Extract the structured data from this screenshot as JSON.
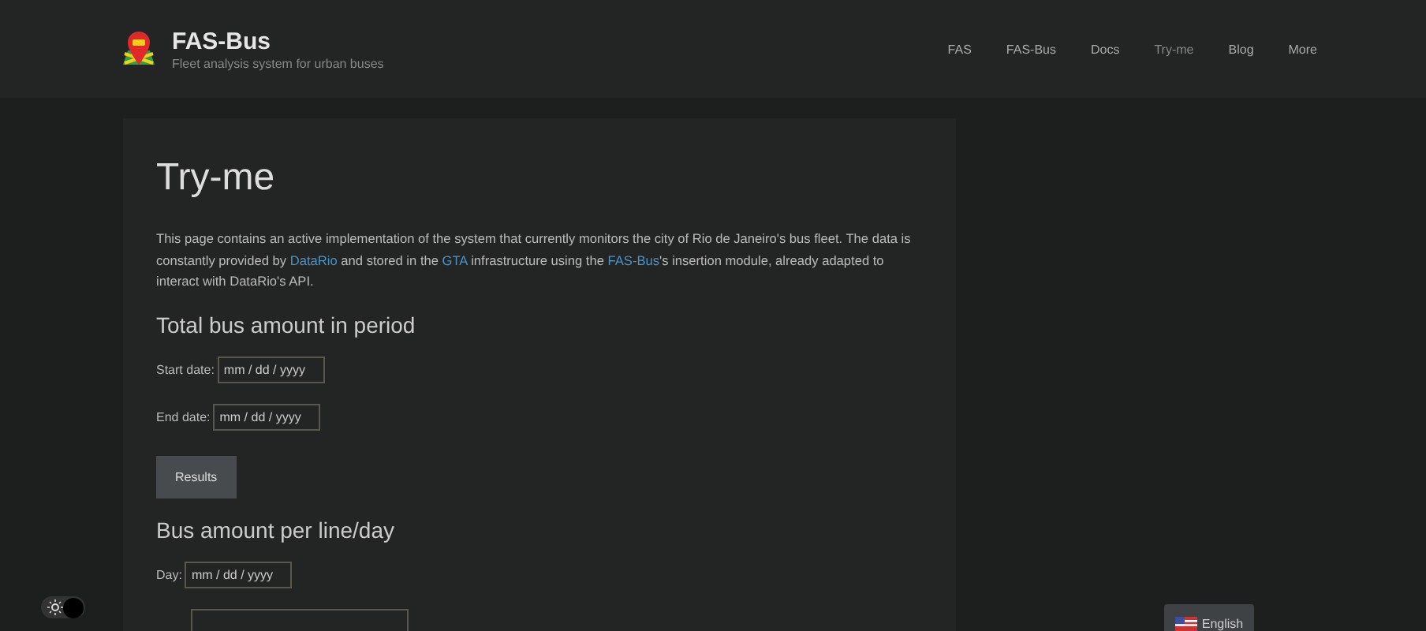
{
  "header": {
    "title": "FAS-Bus",
    "subtitle": "Fleet analysis system for urban buses",
    "nav": [
      {
        "label": "FAS",
        "selected": false
      },
      {
        "label": "FAS-Bus",
        "selected": false
      },
      {
        "label": "Docs",
        "selected": false
      },
      {
        "label": "Try-me",
        "selected": true
      },
      {
        "label": "Blog",
        "selected": false
      },
      {
        "label": "More",
        "selected": false
      }
    ]
  },
  "page": {
    "title": "Try-me",
    "intro": [
      {
        "text": "This page contains an active implementation of the system that currently monitors the city of Rio de Janeiro's bus fleet. The data is constantly provided by "
      },
      {
        "text": "DataRio",
        "link": true
      },
      {
        "text": " and stored in the "
      },
      {
        "text": "GTA",
        "link": true
      },
      {
        "text": " infrastructure using the "
      },
      {
        "text": "FAS-Bus",
        "link": true
      },
      {
        "text": "'s insertion module, already adapted to interact with DataRio's API."
      }
    ],
    "sections": [
      {
        "title": "Total bus amount in period",
        "fields": [
          {
            "label": "Start date:",
            "placeholder": "mm / dd / yyyy"
          },
          {
            "label": "End date:",
            "placeholder": "mm / dd / yyyy"
          }
        ],
        "button": "Results"
      },
      {
        "title": "Bus amount per line/day",
        "fields": [
          {
            "label": "Day:",
            "placeholder": "mm / dd / yyyy"
          }
        ]
      }
    ]
  },
  "theme_toggle": {
    "on": true
  },
  "language_button": "English"
}
